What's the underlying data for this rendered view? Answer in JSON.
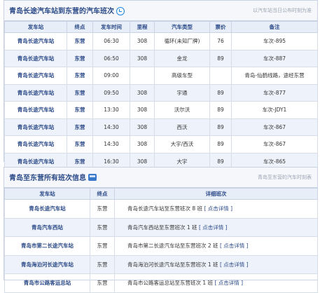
{
  "section1": {
    "title": "青岛长途汽车站到东营的汽车班次",
    "note": "以汽车站当日公布时刻为准",
    "headers": [
      "发车站",
      "终点",
      "发车时间",
      "里程",
      "汽车类型",
      "票价",
      "备注"
    ],
    "rows": [
      {
        "station": "青岛长途汽车站",
        "dest": "东营",
        "time": "06:30",
        "km": "308",
        "type": "循环(未知厂牌)",
        "price": "76",
        "remark": "车次-895"
      },
      {
        "station": "青岛长途汽车站",
        "dest": "东营",
        "time": "06:50",
        "km": "308",
        "type": "金龙",
        "price": "89",
        "remark": "车次-887"
      },
      {
        "station": "青岛长途汽车站",
        "dest": "东营",
        "time": "09:00",
        "km": "",
        "type": "高级车型",
        "price": "",
        "remark": "青岛-仙鹤线路，途经东营"
      },
      {
        "station": "青岛长途汽车站",
        "dest": "东营",
        "time": "09:50",
        "km": "308",
        "type": "宇通",
        "price": "89",
        "remark": "车次-877"
      },
      {
        "station": "青岛长途汽车站",
        "dest": "东营",
        "time": "13:30",
        "km": "308",
        "type": "沃尔沃",
        "price": "89",
        "remark": "车次-JDY1"
      },
      {
        "station": "青岛长途汽车站",
        "dest": "东营",
        "time": "14:30",
        "km": "308",
        "type": "西沃",
        "price": "89",
        "remark": "车次-867"
      },
      {
        "station": "青岛长途汽车站",
        "dest": "东营",
        "time": "14:30",
        "km": "308",
        "type": "大宇/西沃",
        "price": "89",
        "remark": "车次-867"
      },
      {
        "station": "青岛长途汽车站",
        "dest": "东营",
        "time": "16:30",
        "km": "308",
        "type": "大宇",
        "price": "89",
        "remark": "车次-865"
      }
    ]
  },
  "section2": {
    "title": "青岛至东营所有班次信息",
    "note": "青岛至东营的汽车时刻表",
    "headers": [
      "发车站",
      "终点",
      "详细班次"
    ],
    "rows": [
      {
        "station": "青岛长途汽车站",
        "dest": "东营",
        "detail": "青岛长途汽车站至东营班次 8 班",
        "link": "[ 点击详情 ]"
      },
      {
        "station": "青岛汽车西站",
        "dest": "东营",
        "detail": "青岛汽车西站至东营班次 1 班",
        "link": "[ 点击详情 ]"
      },
      {
        "station": "青岛市第二长途汽车站",
        "dest": "东营",
        "detail": "青岛市第二长途汽车站至东营班次 2 班",
        "link": "[ 点击详情 ]"
      },
      {
        "station": "青岛海泊河长途汽车站",
        "dest": "东营",
        "detail": "青岛海泊河长途汽车站至东营班次 1 班",
        "link": "[ 点击详情 ]"
      },
      {
        "station": "青岛市公路客运总站",
        "dest": "东营",
        "detail": "青岛市公路客运总站至东营班次 1 班",
        "link": "[ 点击详情 ]"
      }
    ]
  }
}
